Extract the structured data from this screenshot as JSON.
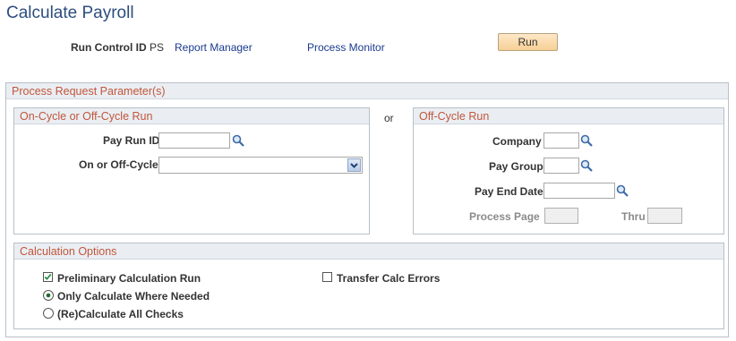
{
  "page": {
    "title": "Calculate Payroll"
  },
  "toolbar": {
    "run_control_label": "Run Control ID",
    "run_control_value": "PS",
    "report_manager": "Report Manager",
    "process_monitor": "Process Monitor",
    "run_button": "Run"
  },
  "process_request": {
    "header": "Process Request Parameter(s)",
    "or_label": "or",
    "on_cycle": {
      "header": "On-Cycle or Off-Cycle Run",
      "pay_run_id_label": "Pay Run ID",
      "pay_run_id_value": "",
      "cycle_label": "On or Off-Cycle",
      "cycle_value": ""
    },
    "off_cycle": {
      "header": "Off-Cycle Run",
      "company_label": "Company",
      "company_value": "",
      "pay_group_label": "Pay Group",
      "pay_group_value": "",
      "pay_end_date_label": "Pay End Date",
      "pay_end_date_value": "",
      "process_page_label": "Process Page",
      "thru_label": "Thru"
    },
    "calculation_options": {
      "header": "Calculation Options",
      "preliminary_label": "Preliminary Calculation Run",
      "preliminary_checked": true,
      "transfer_errors_label": "Transfer Calc Errors",
      "transfer_errors_checked": false,
      "only_calc_label": "Only Calculate Where Needed",
      "recalc_all_label": "(Re)Calculate All Checks",
      "selected_radio": "only_calc"
    }
  },
  "colors": {
    "title": "#2c4d7e",
    "section_header_text": "#c1563a",
    "link": "#1a3a8f",
    "run_button": "#f6cf95"
  }
}
